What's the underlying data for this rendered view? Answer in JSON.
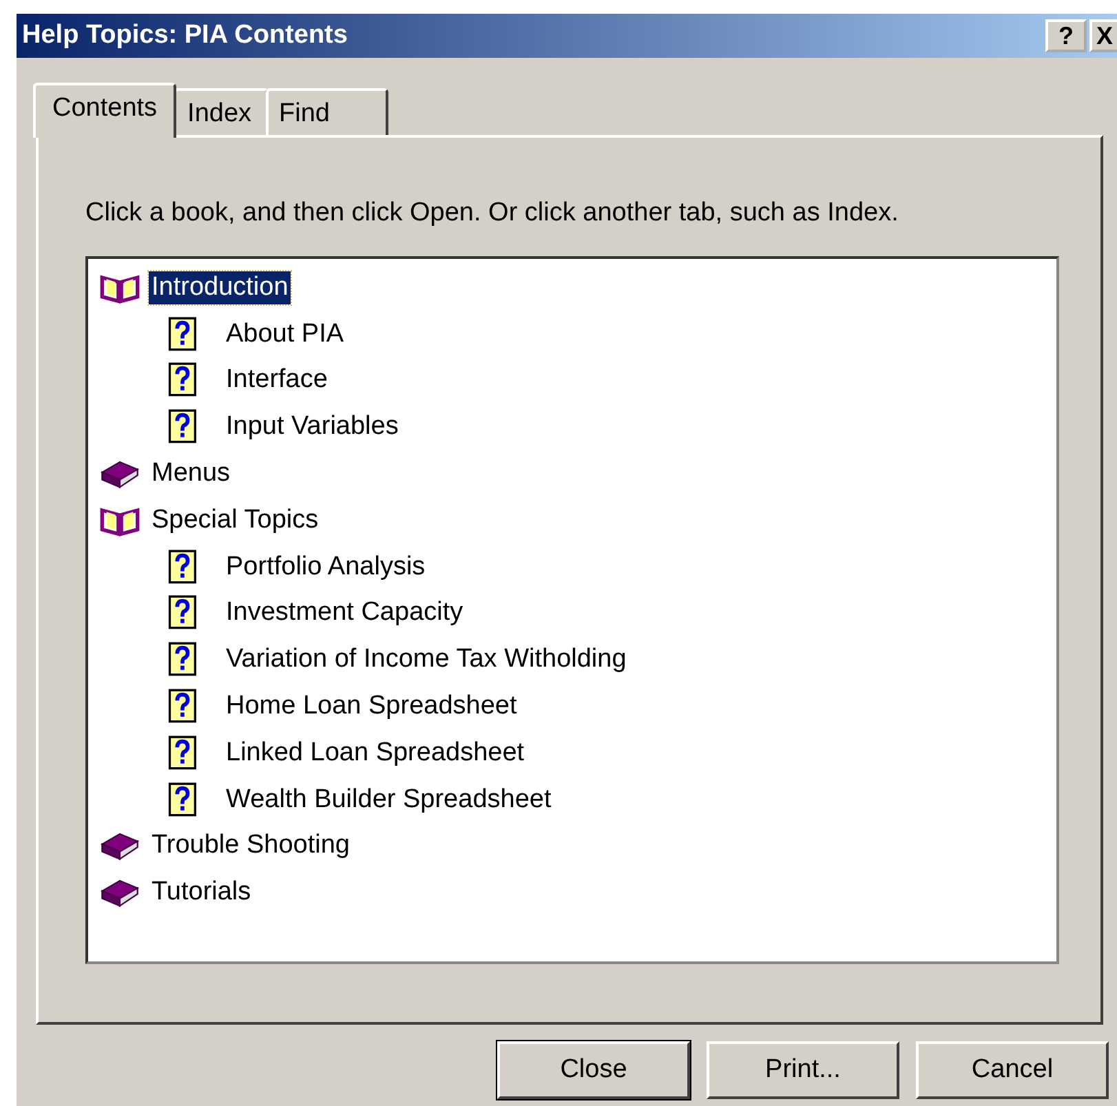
{
  "window": {
    "title": "Help Topics: PIA Contents",
    "title_buttons": [
      "?",
      "X"
    ]
  },
  "tabs": [
    {
      "label": "Contents",
      "selected": true
    },
    {
      "label": "Index",
      "selected": false
    },
    {
      "label": "Find",
      "selected": false
    }
  ],
  "instruction": "Click a book, and then click Open. Or click another tab, such as Index.",
  "tree": [
    {
      "kind": "book",
      "label": "Introduction",
      "expanded": true,
      "selected": true,
      "children": [
        {
          "kind": "topic",
          "label": "About PIA",
          "selected": false
        },
        {
          "kind": "topic",
          "label": "Interface",
          "selected": false
        },
        {
          "kind": "topic",
          "label": "Input Variables",
          "selected": false
        }
      ]
    },
    {
      "kind": "book",
      "label": "Menus",
      "expanded": false,
      "selected": false
    },
    {
      "kind": "book",
      "label": "Special Topics",
      "expanded": true,
      "selected": false,
      "children": [
        {
          "kind": "topic",
          "label": "Portfolio Analysis",
          "selected": false
        },
        {
          "kind": "topic",
          "label": "Investment Capacity",
          "selected": false
        },
        {
          "kind": "topic",
          "label": "Variation of Income Tax Witholding",
          "selected": false
        },
        {
          "kind": "topic",
          "label": "Home Loan Spreadsheet",
          "selected": false
        },
        {
          "kind": "topic",
          "label": "Linked Loan Spreadsheet",
          "selected": false
        },
        {
          "kind": "topic",
          "label": "Wealth Builder Spreadsheet",
          "selected": false
        }
      ]
    },
    {
      "kind": "book",
      "label": "Trouble Shooting",
      "expanded": false,
      "selected": false
    },
    {
      "kind": "book",
      "label": "Tutorials",
      "expanded": false,
      "selected": false
    }
  ],
  "buttons": [
    {
      "label": "Close",
      "default": true
    },
    {
      "label": "Print...",
      "default": false
    },
    {
      "label": "Cancel",
      "default": false
    }
  ]
}
